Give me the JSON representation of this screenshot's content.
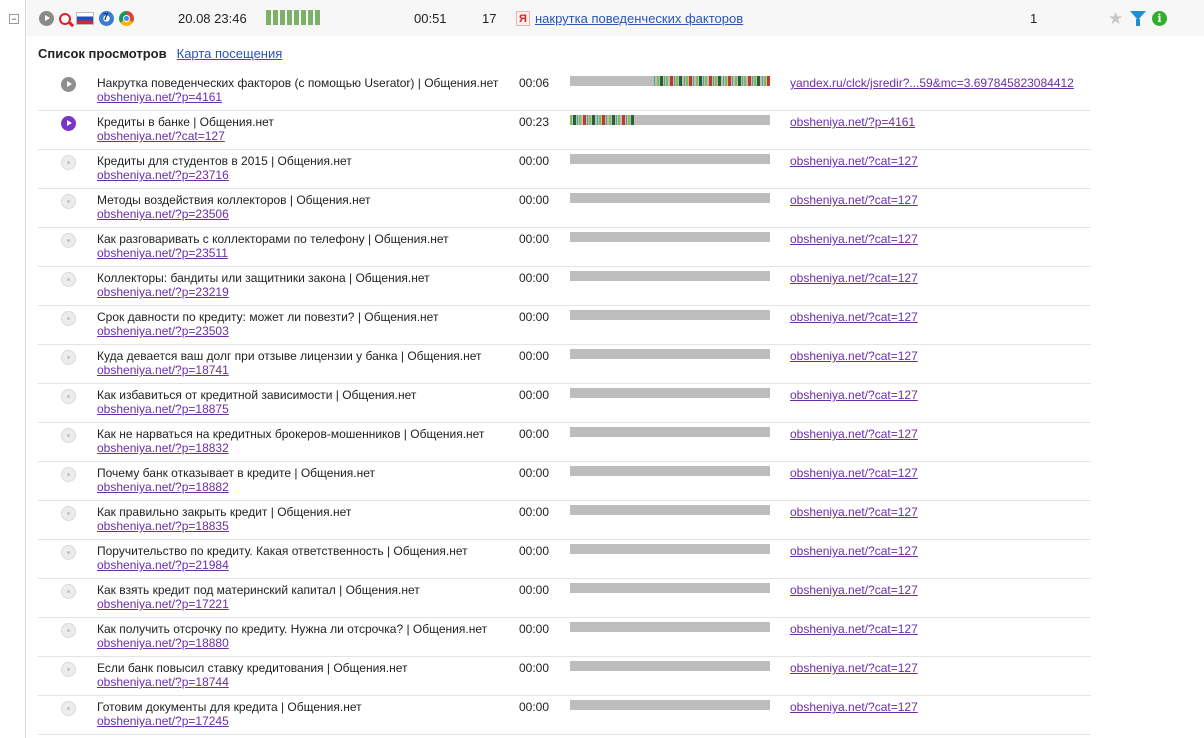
{
  "session": {
    "datetime": "20.08 23:46",
    "duration": "00:51",
    "pages_count": "17",
    "search_engine_icon": "Я",
    "search_query": "накрутка поведенческих факторов",
    "visit_number": "1",
    "browser_icons": [
      "play-icon",
      "search-icon",
      "russia-flag-icon",
      "ie-icon",
      "chrome-icon"
    ],
    "collapse_symbol": "−",
    "star_symbol": "★",
    "info_symbol": "i",
    "activity_bars": 8
  },
  "tabs": {
    "active": "Список просмотров",
    "link": "Карта посещения"
  },
  "colors": {
    "link": "#2a55b8",
    "visited": "#6a2fa6",
    "bar_bg": "#bdbdbd",
    "seg_teal": "#4aa89a",
    "seg_green": "#7fbf4a",
    "seg_red": "#c0392b",
    "seg_dark": "#2b5d3a",
    "active_play": "#7a35c7",
    "info": "#2fae2f",
    "filter": "#1c8fd6"
  },
  "views": [
    {
      "title": "Накрутка поведенческих факторов (с помощью Userator) | Общения.нет",
      "url": "obsheniya.net/?p=4161",
      "time": "00:06",
      "referrer": "yandex.ru/clck/jsredir?...59&mc=3.697845823084412",
      "state": "watched",
      "activity": {
        "start": 0.42,
        "end": 1.0
      }
    },
    {
      "title": "Кредиты в банке | Общения.нет",
      "url": "obsheniya.net/?cat=127",
      "time": "00:23",
      "referrer": "obsheniya.net/?p=4161",
      "state": "active",
      "activity": {
        "start": 0.0,
        "end": 0.32
      }
    },
    {
      "title": "Кредиты для студентов в 2015 | Общения.нет",
      "url": "obsheniya.net/?p=23716",
      "time": "00:00",
      "referrer": "obsheniya.net/?cat=127",
      "state": "idle"
    },
    {
      "title": "Методы воздействия коллекторов | Общения.нет",
      "url": "obsheniya.net/?p=23506",
      "time": "00:00",
      "referrer": "obsheniya.net/?cat=127",
      "state": "idle"
    },
    {
      "title": "Как разговаривать с коллекторами по телефону | Общения.нет",
      "url": "obsheniya.net/?p=23511",
      "time": "00:00",
      "referrer": "obsheniya.net/?cat=127",
      "state": "idle"
    },
    {
      "title": "Коллекторы: бандиты или защитники закона | Общения.нет",
      "url": "obsheniya.net/?p=23219",
      "time": "00:00",
      "referrer": "obsheniya.net/?cat=127",
      "state": "idle"
    },
    {
      "title": "Срок давности по кредиту: может ли повезти? | Общения.нет",
      "url": "obsheniya.net/?p=23503",
      "time": "00:00",
      "referrer": "obsheniya.net/?cat=127",
      "state": "idle"
    },
    {
      "title": "Куда девается ваш долг при отзыве лицензии у банка | Общения.нет",
      "url": "obsheniya.net/?p=18741",
      "time": "00:00",
      "referrer": "obsheniya.net/?cat=127",
      "state": "idle"
    },
    {
      "title": "Как избавиться от кредитной зависимости | Общения.нет",
      "url": "obsheniya.net/?p=18875",
      "time": "00:00",
      "referrer": "obsheniya.net/?cat=127",
      "state": "idle"
    },
    {
      "title": "Как не нарваться на кредитных брокеров-мошенников | Общения.нет",
      "url": "obsheniya.net/?p=18832",
      "time": "00:00",
      "referrer": "obsheniya.net/?cat=127",
      "state": "idle"
    },
    {
      "title": "Почему банк отказывает в кредите | Общения.нет",
      "url": "obsheniya.net/?p=18882",
      "time": "00:00",
      "referrer": "obsheniya.net/?cat=127",
      "state": "idle"
    },
    {
      "title": "Как правильно закрыть кредит | Общения.нет",
      "url": "obsheniya.net/?p=18835",
      "time": "00:00",
      "referrer": "obsheniya.net/?cat=127",
      "state": "idle"
    },
    {
      "title": "Поручительство по кредиту. Какая ответственность | Общения.нет",
      "url": "obsheniya.net/?p=21984",
      "time": "00:00",
      "referrer": "obsheniya.net/?cat=127",
      "state": "idle"
    },
    {
      "title": "Как взять кредит под материнский капитал | Общения.нет",
      "url": "obsheniya.net/?p=17221",
      "time": "00:00",
      "referrer": "obsheniya.net/?cat=127",
      "state": "idle"
    },
    {
      "title": "Как получить отсрочку по кредиту. Нужна ли отсрочка? | Общения.нет",
      "url": "obsheniya.net/?p=18880",
      "time": "00:00",
      "referrer": "obsheniya.net/?cat=127",
      "state": "idle"
    },
    {
      "title": "Если банк повысил ставку кредитования | Общения.нет",
      "url": "obsheniya.net/?p=18744",
      "time": "00:00",
      "referrer": "obsheniya.net/?cat=127",
      "state": "idle"
    },
    {
      "title": "Готовим документы для кредита | Общения.нет",
      "url": "obsheniya.net/?p=17245",
      "time": "00:00",
      "referrer": "obsheniya.net/?cat=127",
      "state": "idle"
    }
  ]
}
